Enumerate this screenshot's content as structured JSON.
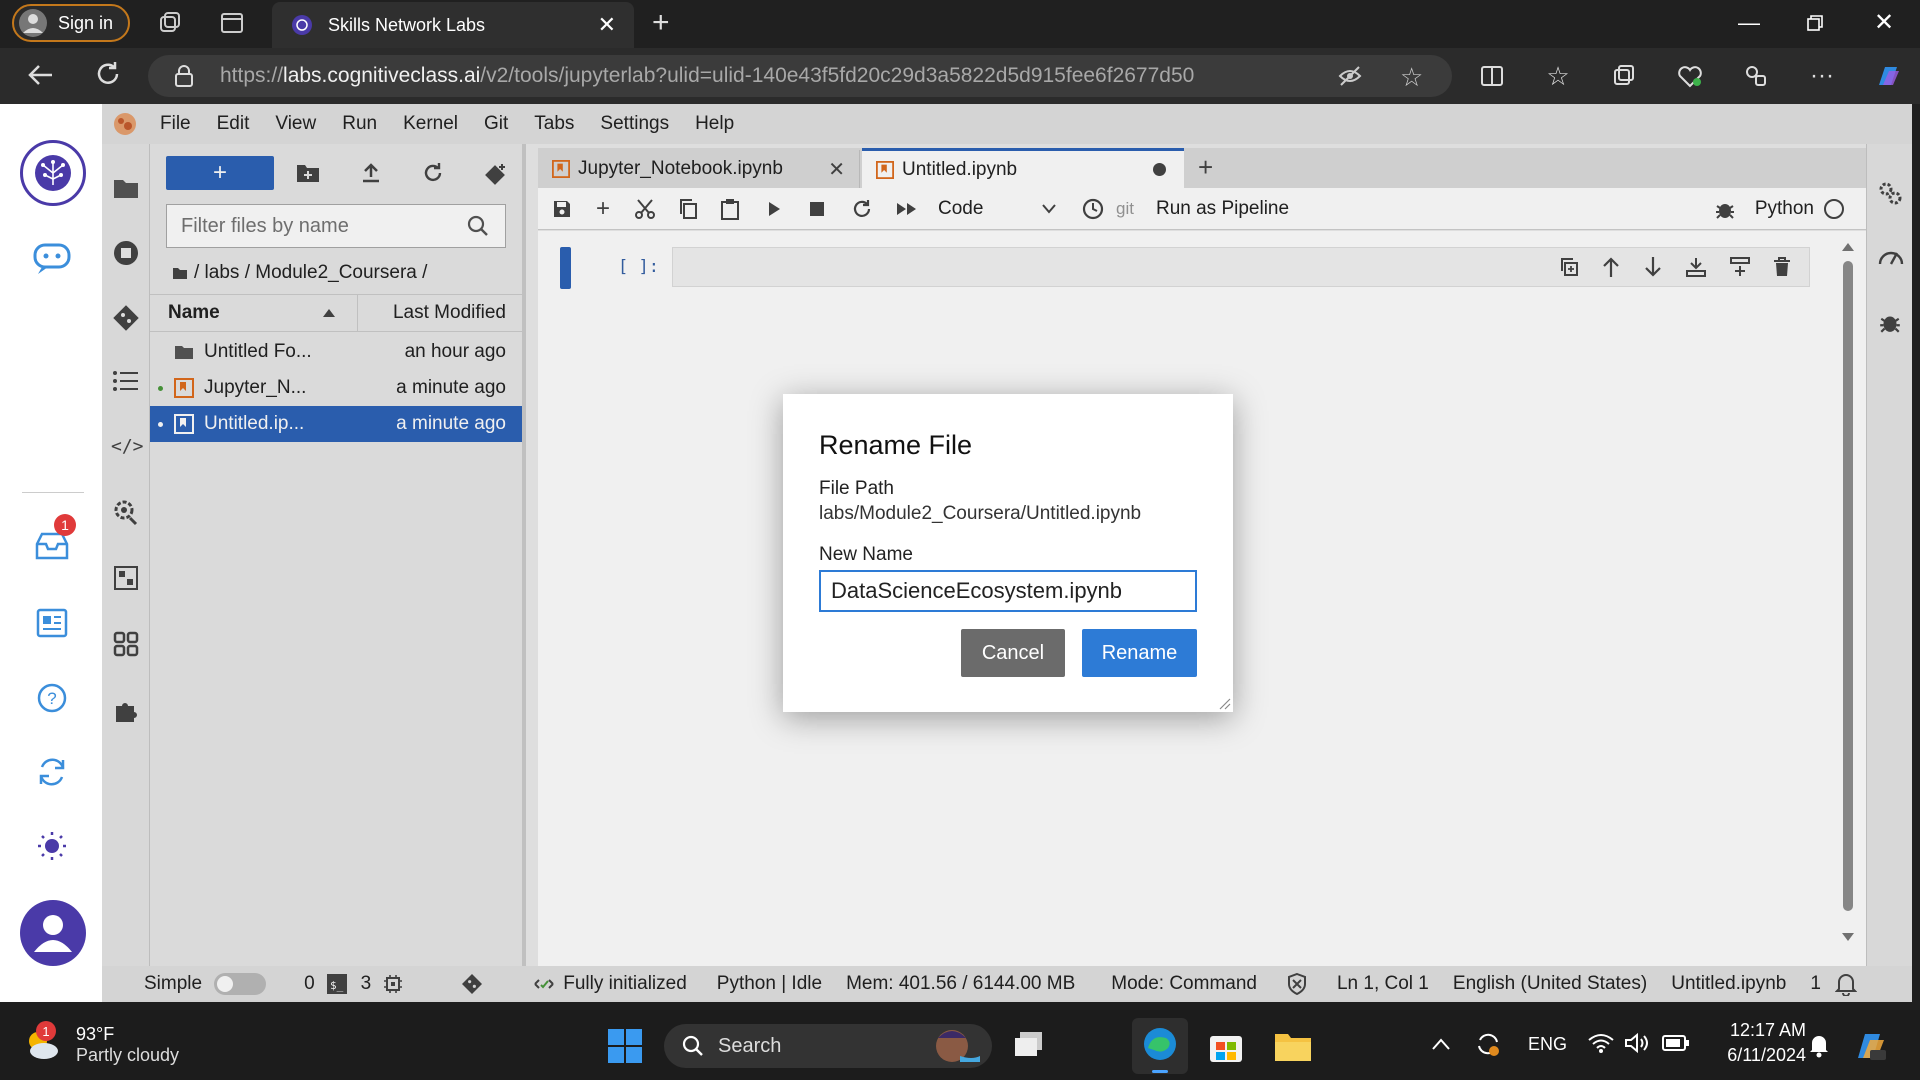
{
  "browser": {
    "sign_in": "Sign in",
    "tab_title": "Skills Network Labs",
    "url_prefix": "https://",
    "url_host": "labs.cognitiveclass.ai",
    "url_path": "/v2/tools/jupyterlab?ulid=ulid-140e43f5fd20c29d3a5822d5d915fee6f2677d50"
  },
  "skills_rail": {
    "notification_count": "1",
    "brand_color": "#4a3aa8"
  },
  "menu": [
    "File",
    "Edit",
    "View",
    "Run",
    "Kernel",
    "Git",
    "Tabs",
    "Settings",
    "Help"
  ],
  "filebrowser": {
    "new_label": "+",
    "filter_placeholder": "Filter files by name",
    "breadcrumb": "/ labs / Module2_Coursera /",
    "col_name": "Name",
    "col_modified": "Last Modified",
    "files": [
      {
        "name": "Untitled Fo...",
        "modified": "an hour ago",
        "type": "folder",
        "running": false,
        "selected": false
      },
      {
        "name": "Jupyter_N...",
        "modified": "a minute ago",
        "type": "notebook",
        "running": true,
        "selected": false
      },
      {
        "name": "Untitled.ip...",
        "modified": "a minute ago",
        "type": "notebook",
        "running": true,
        "selected": true
      }
    ]
  },
  "notebook": {
    "tabs": [
      {
        "label": "Jupyter_Notebook.ipynb",
        "active": false
      },
      {
        "label": "Untitled.ipynb",
        "active": true
      }
    ],
    "cell_type": "Code",
    "git_label": "git",
    "pipeline_label": "Run as Pipeline",
    "kernel": "Python",
    "cell_prompt": "[ ]:"
  },
  "dialog": {
    "title": "Rename File",
    "path_label": "File Path",
    "path_value": "labs/Module2_Coursera/Untitled.ipynb",
    "name_label": "New Name",
    "name_value": "DataScienceEcosystem.ipynb",
    "cancel": "Cancel",
    "rename": "Rename"
  },
  "status": {
    "mode_label": "Simple",
    "terminals": "0",
    "kernels": "3",
    "init": "Fully initialized",
    "kernel_status": "Python | Idle",
    "mem": "Mem: 401.56 / 6144.00 MB",
    "command_mode": "Mode: Command",
    "position": "Ln 1, Col 1",
    "language": "English (United States)",
    "file": "Untitled.ipynb",
    "count": "1"
  },
  "taskbar": {
    "weather_temp": "93°F",
    "weather_desc": "Partly cloudy",
    "weather_badge": "1",
    "search": "Search",
    "lang": "ENG",
    "time": "12:17 AM",
    "date": "6/11/2024"
  }
}
